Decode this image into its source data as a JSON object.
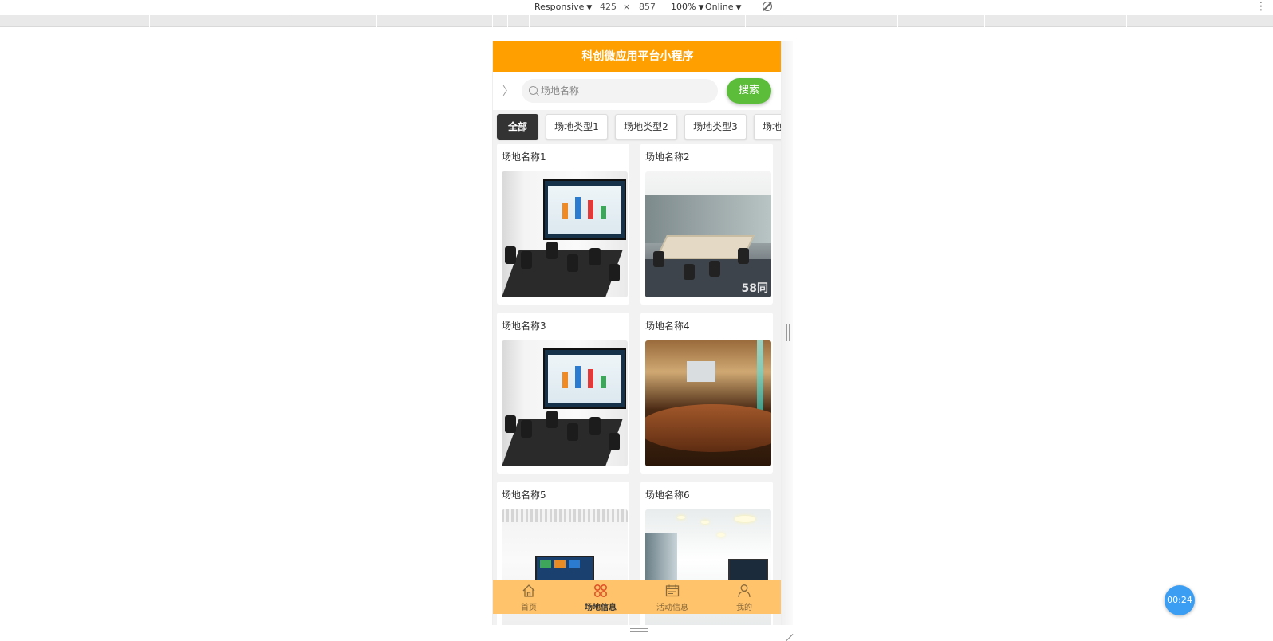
{
  "devtools": {
    "device_mode": "Responsive",
    "width": "425",
    "times": "×",
    "height": "857",
    "zoom": "100%",
    "network": "Online",
    "caret": "▼",
    "more_glyph": "⋮"
  },
  "app": {
    "title": "科创微应用平台小程序",
    "back_glyph": "〉",
    "search": {
      "placeholder": "场地名称",
      "button_label": "搜索"
    },
    "tabs": [
      "全部",
      "场地类型1",
      "场地类型2",
      "场地类型3",
      "场地"
    ],
    "venues": [
      {
        "name": "场地名称1"
      },
      {
        "name": "场地名称2",
        "watermark": "58同"
      },
      {
        "name": "场地名称3"
      },
      {
        "name": "场地名称4"
      },
      {
        "name": "场地名称5"
      },
      {
        "name": "场地名称6"
      }
    ],
    "nav": [
      {
        "label": "首页",
        "icon": "home-icon"
      },
      {
        "label": "场地信息",
        "icon": "venue-icon"
      },
      {
        "label": "活动信息",
        "icon": "calendar-icon"
      },
      {
        "label": "我的",
        "icon": "user-icon"
      }
    ]
  },
  "timer": "00:24",
  "colors": {
    "header": "#ff9f00",
    "search_button": "#5cbd3b",
    "tabbar": "#ffc36b",
    "active_nav_icon": "#e0542a",
    "timer": "#3b9ef2"
  }
}
